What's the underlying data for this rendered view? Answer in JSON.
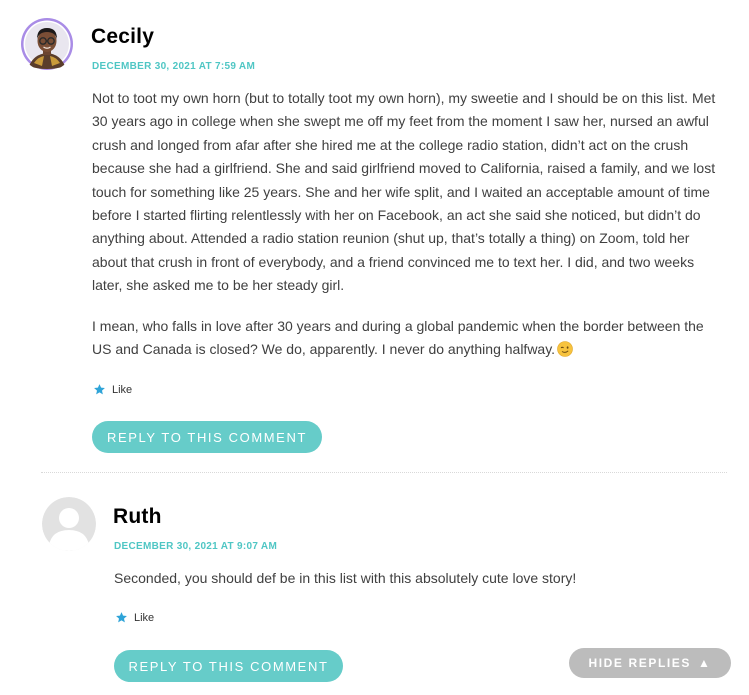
{
  "comments": [
    {
      "author": "Cecily",
      "date": "DECEMBER 30, 2021 AT 7:59 AM",
      "paragraphs": [
        "Not to toot my own horn (but to totally toot my own horn), my sweetie and I should be on this list. Met 30 years ago in college when she swept me off my feet from the moment I saw her, nursed an awful crush and longed from afar after she hired me at the college radio station, didn’t act on the crush because she had a girlfriend. She and said girlfriend moved to California, raised a family, and we lost touch for something like 25 years. She and her wife split, and I waited an acceptable amount of time before I started flirting relentlessly with her on Facebook, an act she said she noticed, but didn’t do anything about. Attended a radio station reunion (shut up, that’s totally a thing) on Zoom, told her about that crush in front of everybody, and a friend convinced me to text her. I did, and two weeks later, she asked me to be her steady girl.",
        "I mean, who falls in love after 30 years and during a global pandemic when the border between the US and Canada is closed? We do, apparently. I never do anything halfway."
      ],
      "like_label": "Like",
      "reply_label": "REPLY TO THIS COMMENT"
    },
    {
      "author": "Ruth",
      "date": "DECEMBER 30, 2021 AT 9:07 AM",
      "paragraphs": [
        "Seconded, you should def be in this list with this absolutely cute love story!"
      ],
      "like_label": "Like",
      "reply_label": "REPLY TO THIS COMMENT"
    }
  ],
  "hide_replies_label": "HIDE REPLIES",
  "icons": {
    "like": "star-icon",
    "emoji": "winking-face-icon",
    "hide_replies": "triangle-up-icon",
    "avatar_default": "default-user-avatar"
  },
  "colors": {
    "accent": "#4fc6c4",
    "reply_button": "#66ccc9",
    "hide_replies_button": "#bcbcbc",
    "avatar_ring": "#a98ce6"
  }
}
